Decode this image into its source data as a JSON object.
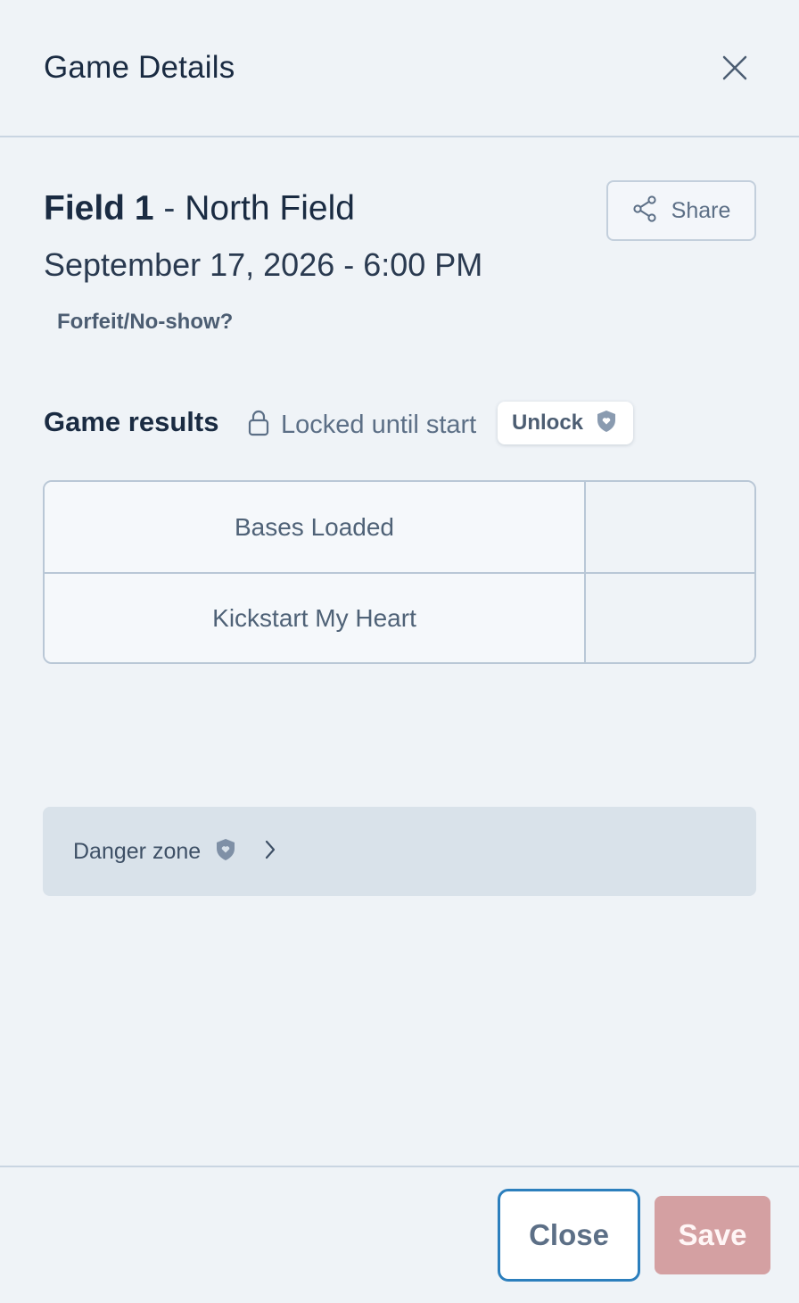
{
  "header": {
    "title": "Game Details",
    "close_icon": "close-x-icon"
  },
  "game": {
    "field_name": "Field 1",
    "separator": " - ",
    "location": "North Field",
    "datetime": "September 17, 2026 - 6:00 PM",
    "share_label": "Share",
    "forfeit_label": "Forfeit/No-show?"
  },
  "results": {
    "title": "Game results",
    "lock_status": "Locked until start",
    "unlock_label": "Unlock",
    "teams": [
      {
        "name": "Bases Loaded",
        "score": ""
      },
      {
        "name": "Kickstart My Heart",
        "score": ""
      }
    ]
  },
  "danger_zone": {
    "label": "Danger zone"
  },
  "footer": {
    "close_label": "Close",
    "save_label": "Save"
  },
  "colors": {
    "background": "#eff3f7",
    "primary_text": "#1a2b42",
    "muted_text": "#5c6f86",
    "close_border": "#2c7fbd",
    "save_disabled": "#d4a0a2",
    "danger_bg": "#d9e2ea"
  }
}
